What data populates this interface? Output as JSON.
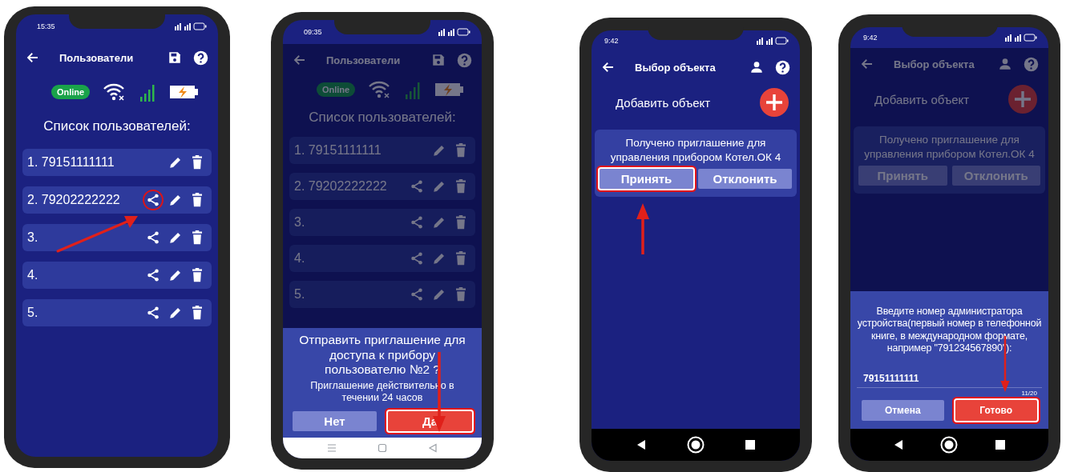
{
  "phones": [
    {
      "kind": "users",
      "time": "15:35",
      "title": "Пользователи",
      "dimmed": false,
      "pointer": {
        "kind": "diagonal"
      },
      "badge": "Online",
      "list_title": "Список пользователей:",
      "users": [
        {
          "label": "1. 79151111111",
          "shareable": false,
          "highlighted": false
        },
        {
          "label": "2. 79202222222",
          "shareable": true,
          "highlighted": true
        },
        {
          "label": "3.",
          "shareable": true,
          "highlighted": false
        },
        {
          "label": "4.",
          "shareable": true,
          "highlighted": false
        },
        {
          "label": "5.",
          "shareable": true,
          "highlighted": false
        }
      ]
    },
    {
      "kind": "users",
      "time": "09:35",
      "title": "Пользователи",
      "dimmed": true,
      "pointer": {
        "kind": "down"
      },
      "badge": "Online",
      "list_title": "Список пользователей:",
      "users": [
        {
          "label": "1. 79151111111",
          "shareable": false,
          "highlighted": false
        },
        {
          "label": "2. 79202222222",
          "shareable": true,
          "highlighted": false
        },
        {
          "label": "3.",
          "shareable": true,
          "highlighted": false
        },
        {
          "label": "4.",
          "shareable": true,
          "highlighted": false
        },
        {
          "label": "5.",
          "shareable": true,
          "highlighted": false
        }
      ],
      "dialog": {
        "kind": "confirm",
        "message": "Отправить приглашение для доступа к прибору пользователю №2 ?",
        "note": "Приглашение действительно в течении 24 часов",
        "buttons": [
          {
            "label": "Нет",
            "kind": "secondary",
            "highlighted": false
          },
          {
            "label": "Да",
            "kind": "primary",
            "highlighted": true
          }
        ]
      },
      "nav_bar": {
        "kind": "light"
      }
    },
    {
      "kind": "objects",
      "time": "9:42",
      "title": "Выбор объекта",
      "dimmed": false,
      "pointer": {
        "kind": "up"
      },
      "add_label": "Добавить объект",
      "invitation": {
        "text": "Получено приглашение для управления прибором Котел.ОК 4",
        "buttons": [
          {
            "label": "Принять",
            "kind": "secondary",
            "highlighted": true
          },
          {
            "label": "Отклонить",
            "kind": "secondary",
            "highlighted": false
          }
        ]
      },
      "nav_bar": {
        "kind": "dark"
      }
    },
    {
      "kind": "objects",
      "time": "9:42",
      "title": "Выбор объекта",
      "dimmed": true,
      "pointer": {
        "kind": "down"
      },
      "add_label": "Добавить объект",
      "invitation": {
        "text": "Получено приглашение для управления прибором Котел.ОК 4",
        "buttons": [
          {
            "label": "Принять",
            "kind": "secondary",
            "highlighted": false
          },
          {
            "label": "Отклонить",
            "kind": "secondary",
            "highlighted": false
          }
        ]
      },
      "dialog": {
        "kind": "input",
        "message": "Введите номер администратора устройства(первый номер в телефонной книге, в международном формате, например \"791234567890\"):",
        "value": "79151111111",
        "counter": "11/20",
        "buttons": [
          {
            "label": "Отмена",
            "kind": "secondary",
            "highlighted": false
          },
          {
            "label": "Готово",
            "kind": "primary",
            "highlighted": true
          }
        ]
      },
      "nav_bar": {
        "kind": "dark"
      }
    }
  ]
}
